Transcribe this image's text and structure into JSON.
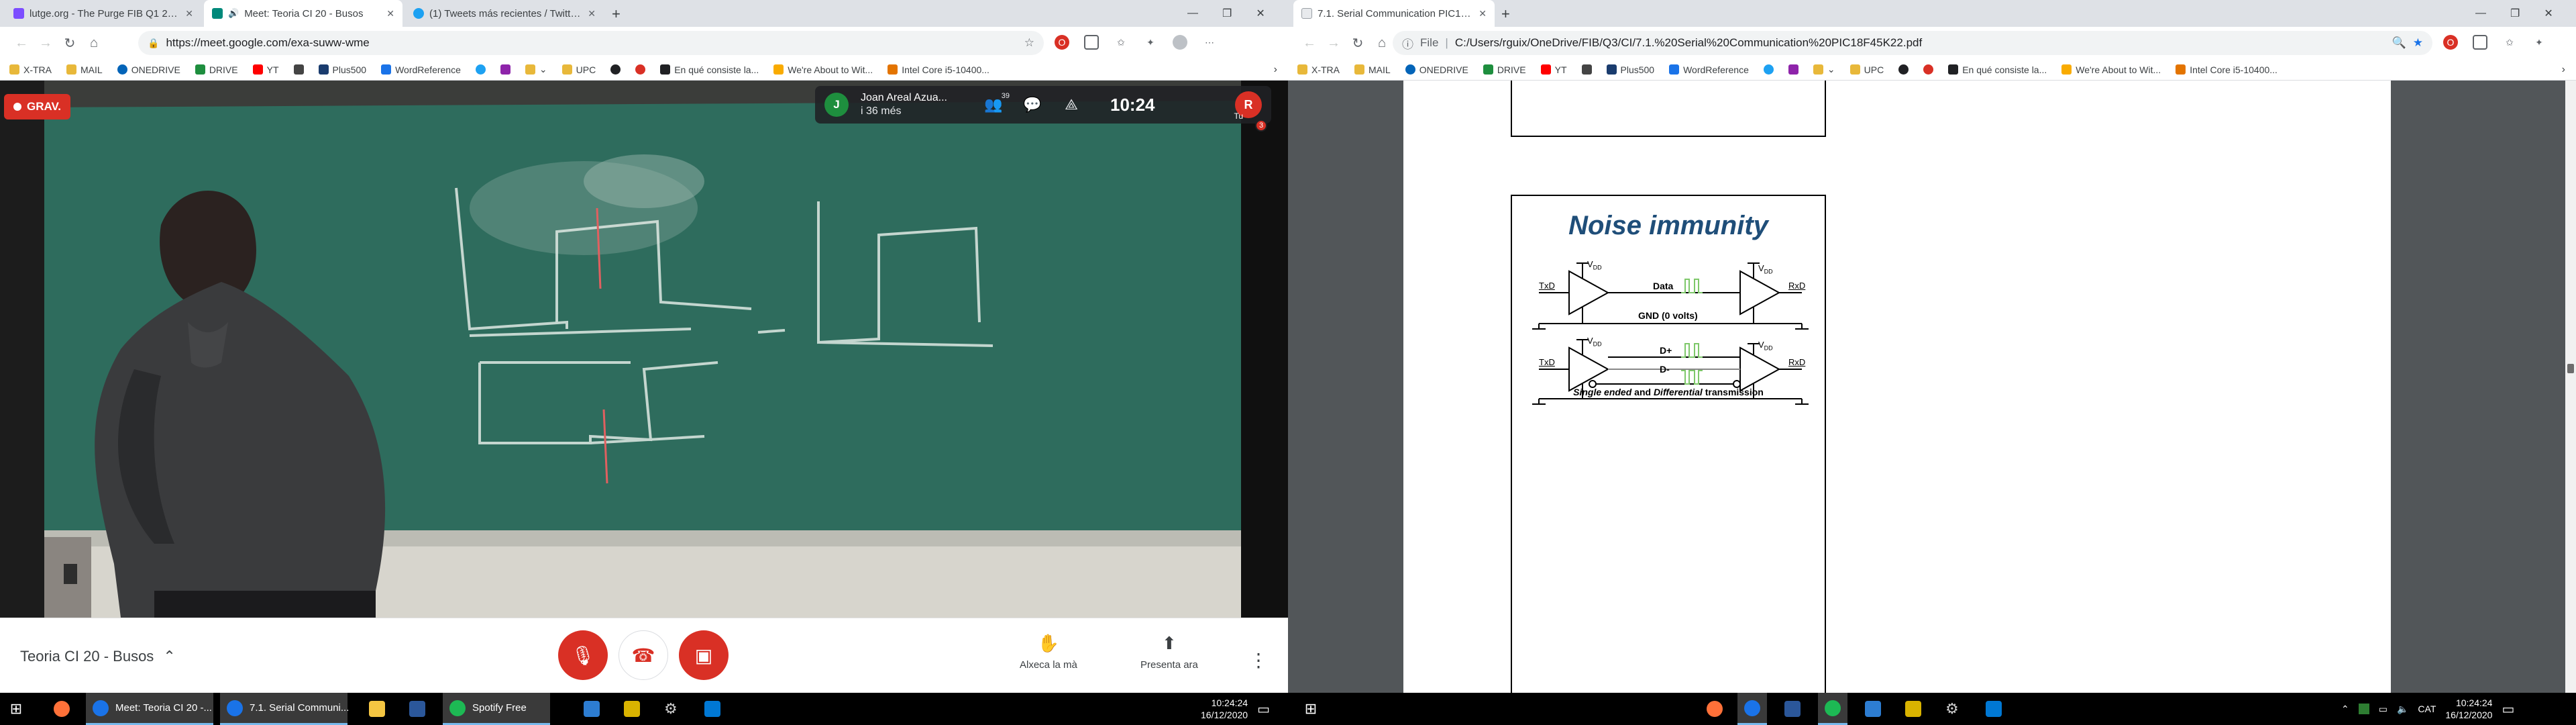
{
  "left_window": {
    "tabs": [
      {
        "title": "lutge.org - The Purge FIB Q1 20..."
      },
      {
        "title": "Meet: Teoria CI 20 - Busos"
      },
      {
        "title": "(1) Tweets más recientes / Twitte..."
      }
    ],
    "url": "https://meet.google.com/exa-suww-wme",
    "meet": {
      "rec_label": "GRAV.",
      "presenter_initial": "J",
      "presenter_name": "Joan Areal Azua...",
      "presenter_sub": "i 36 més",
      "participants_count": "39",
      "clock": "10:24",
      "you_label": "Tu",
      "self_initial": "R",
      "self_badge": "3",
      "meeting_name": "Teoria CI 20 - Busos",
      "raise_hand_label": "Alxeca la mà",
      "present_label": "Presenta ara"
    }
  },
  "right_window": {
    "tabs": [
      {
        "title": "7.1. Serial Communication PIC18..."
      }
    ],
    "url_prefix": "File",
    "url": "C:/Users/rguix/OneDrive/FIB/Q3/CI/7.1.%20Serial%20Communication%20PIC18F45K22.pdf",
    "slide": {
      "title": "Noise immunity",
      "vdd": "V",
      "vdd_sub": "DD",
      "txd": "TxD",
      "rxd": "RxD",
      "data_label": "Data",
      "gnd_label": "GND (0 volts)",
      "dplus": "D+",
      "dminus": "D-",
      "caption_a": "Single ended",
      "caption_and": "and",
      "caption_b": "Differential",
      "caption_c": "transmission"
    }
  },
  "bookmarks": [
    {
      "label": "X-TRA",
      "color": "#e8b83a"
    },
    {
      "label": "MAIL",
      "color": "#e8b83a"
    },
    {
      "label": "ONEDRIVE",
      "color": "#0364b8"
    },
    {
      "label": "DRIVE",
      "color": "#1e8e3e"
    },
    {
      "label": "YT",
      "color": "#ff0000"
    },
    {
      "label": "",
      "color": "#444444"
    },
    {
      "label": "Plus500",
      "color": "#1a3c6e"
    },
    {
      "label": "WordReference",
      "color": "#1a73e8"
    },
    {
      "label": "",
      "color": "#1da1f2"
    },
    {
      "label": "",
      "color": "#8e24aa"
    },
    {
      "label": "",
      "color": "#e8b83a"
    },
    {
      "label": "UPC",
      "color": "#e8b83a"
    },
    {
      "label": "",
      "color": "#202124"
    },
    {
      "label": "",
      "color": "#d93025"
    },
    {
      "label": "En qué consiste la...",
      "color": "#202124"
    },
    {
      "label": "We're About to Wit...",
      "color": "#f9ab00"
    },
    {
      "label": "Intel Core i5-10400...",
      "color": "#e37400"
    }
  ],
  "taskbar": {
    "items": [
      {
        "label": "Meet: Teoria CI 20 -...",
        "color": "#1a73e8"
      },
      {
        "label": "7.1. Serial Communi...",
        "color": "#1a73e8"
      },
      {
        "label": "Spotify Free",
        "color": "#1db954"
      }
    ],
    "time": "10:24:24",
    "date": "16/12/2020",
    "lang": "CAT"
  },
  "colors": {
    "chalkboard": "#2d6b5c",
    "rec_red": "#d93025",
    "slide_title": "#1f4e79",
    "signal_green": "#7ec86a"
  }
}
